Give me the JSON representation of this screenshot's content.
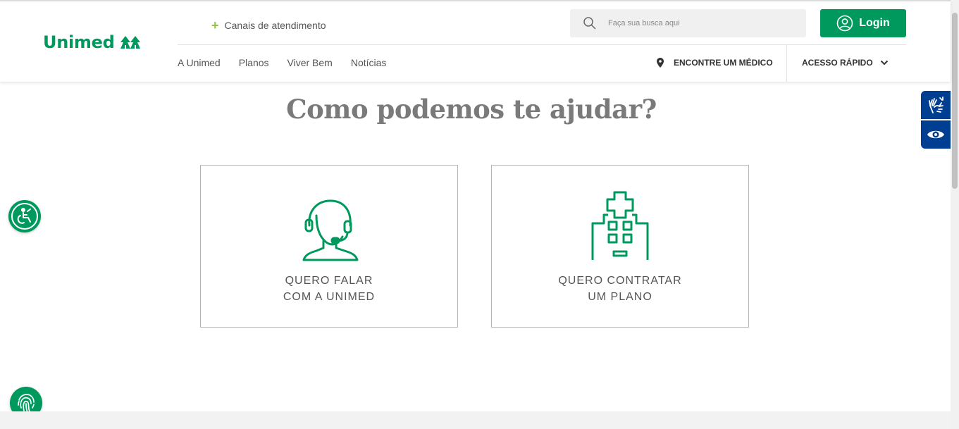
{
  "header": {
    "logo_text": "Unimed",
    "canais_label": "Canais de atendimento",
    "search": {
      "placeholder": "Faça sua busca aqui"
    },
    "login_label": "Login",
    "nav": [
      "A Unimed",
      "Planos",
      "Viver Bem",
      "Notícias"
    ],
    "encontre_label": "ENCONTRE UM MÉDICO",
    "acesso_label": "ACESSO RÁPIDO"
  },
  "main": {
    "title": "Como podemos te ajudar?",
    "cards": [
      {
        "line1": "QUERO FALAR",
        "line2": "COM A UNIMED",
        "icon": "headset-support-icon"
      },
      {
        "line1": "QUERO CONTRATAR",
        "line2": "UM PLANO",
        "icon": "hospital-icon"
      }
    ]
  },
  "colors": {
    "brand_green": "#00995d",
    "accent_lime": "#8cc63f",
    "accessibility_blue": "#003e92"
  },
  "icons": [
    "plus-icon",
    "search-icon",
    "user-circle-icon",
    "location-pin-icon",
    "chevron-down-icon",
    "sign-language-icon",
    "eye-icon",
    "wheelchair-icon",
    "fingerprint-icon"
  ]
}
